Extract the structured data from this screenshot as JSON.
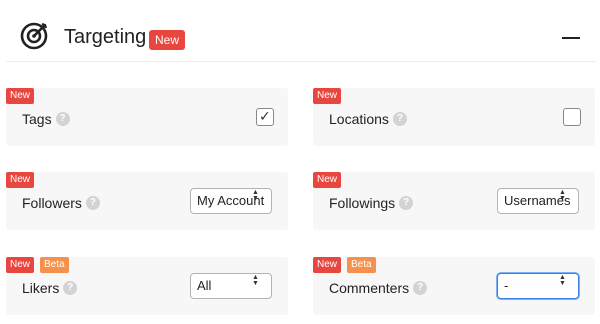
{
  "header": {
    "title": "Targeting",
    "badge": "New"
  },
  "badges": {
    "new": "New",
    "beta": "Beta"
  },
  "help_glyph": "?",
  "cards": {
    "tags": {
      "label": "Tags",
      "checked": true
    },
    "locations": {
      "label": "Locations",
      "checked": false
    },
    "followers": {
      "label": "Followers",
      "value": "My Account"
    },
    "followings": {
      "label": "Followings",
      "value": "Usernames"
    },
    "likers": {
      "label": "Likers",
      "value": "All"
    },
    "commenters": {
      "label": "Commenters",
      "value": "-"
    }
  },
  "colors": {
    "accent": "#e8473f",
    "beta": "#f5914a",
    "focus": "#3b80e4"
  }
}
